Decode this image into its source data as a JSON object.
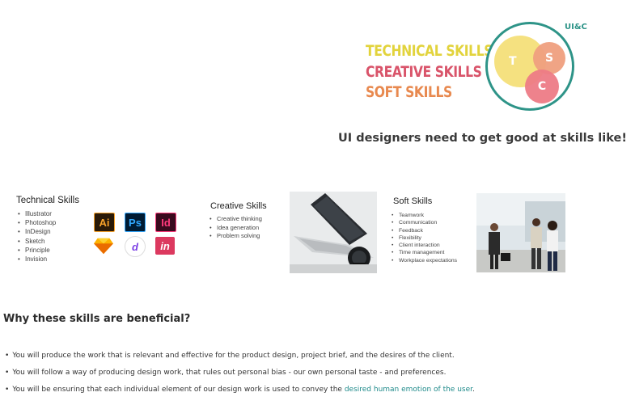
{
  "banner": {
    "lines": [
      "TECHNICAL SKILLS",
      "CREATIVE SKILLS",
      "SOFT SKILLS"
    ],
    "venn_letters": [
      "T",
      "S",
      "C"
    ],
    "badge": "UI&C",
    "colors": {
      "technical": "#e2d33c",
      "creative": "#d9546a",
      "soft": "#e8894f",
      "ring": "#2e9488"
    }
  },
  "heading": "UI designers need to get good at skills like!",
  "technical": {
    "title": "Technical Skills",
    "items": [
      "Illustrator",
      "Photoshop",
      "InDesign",
      "Sketch",
      "Principle",
      "Invision"
    ],
    "icons": [
      {
        "name": "illustrator-icon",
        "label": "Ai"
      },
      {
        "name": "photoshop-icon",
        "label": "Ps"
      },
      {
        "name": "indesign-icon",
        "label": "Id"
      },
      {
        "name": "sketch-icon",
        "label": ""
      },
      {
        "name": "principle-icon",
        "label": "d"
      },
      {
        "name": "invision-icon",
        "label": "in"
      }
    ]
  },
  "creative": {
    "title": "Creative Skills",
    "items": [
      "Creative thinking",
      "Idea generation",
      "Problem solving"
    ]
  },
  "soft": {
    "title": "Soft Skills",
    "items": [
      "Teamwork",
      "Communication",
      "Feedback",
      "Flexibility",
      "Client interaction",
      "Time management",
      "Workplace expectations"
    ]
  },
  "why": {
    "title": "Why these skills are beneficial?",
    "bullets": [
      "You will produce the work that is relevant and effective for the product design, project brief, and the desires of the client.",
      "You will follow a way of producing design work, that rules out personal bias - our own personal taste - and preferences."
    ],
    "bullet3_prefix": "You will be ensuring that each individual element of our design work is used to convey the ",
    "bullet3_link": "desired human emotion of the user",
    "bullet3_suffix": "."
  }
}
